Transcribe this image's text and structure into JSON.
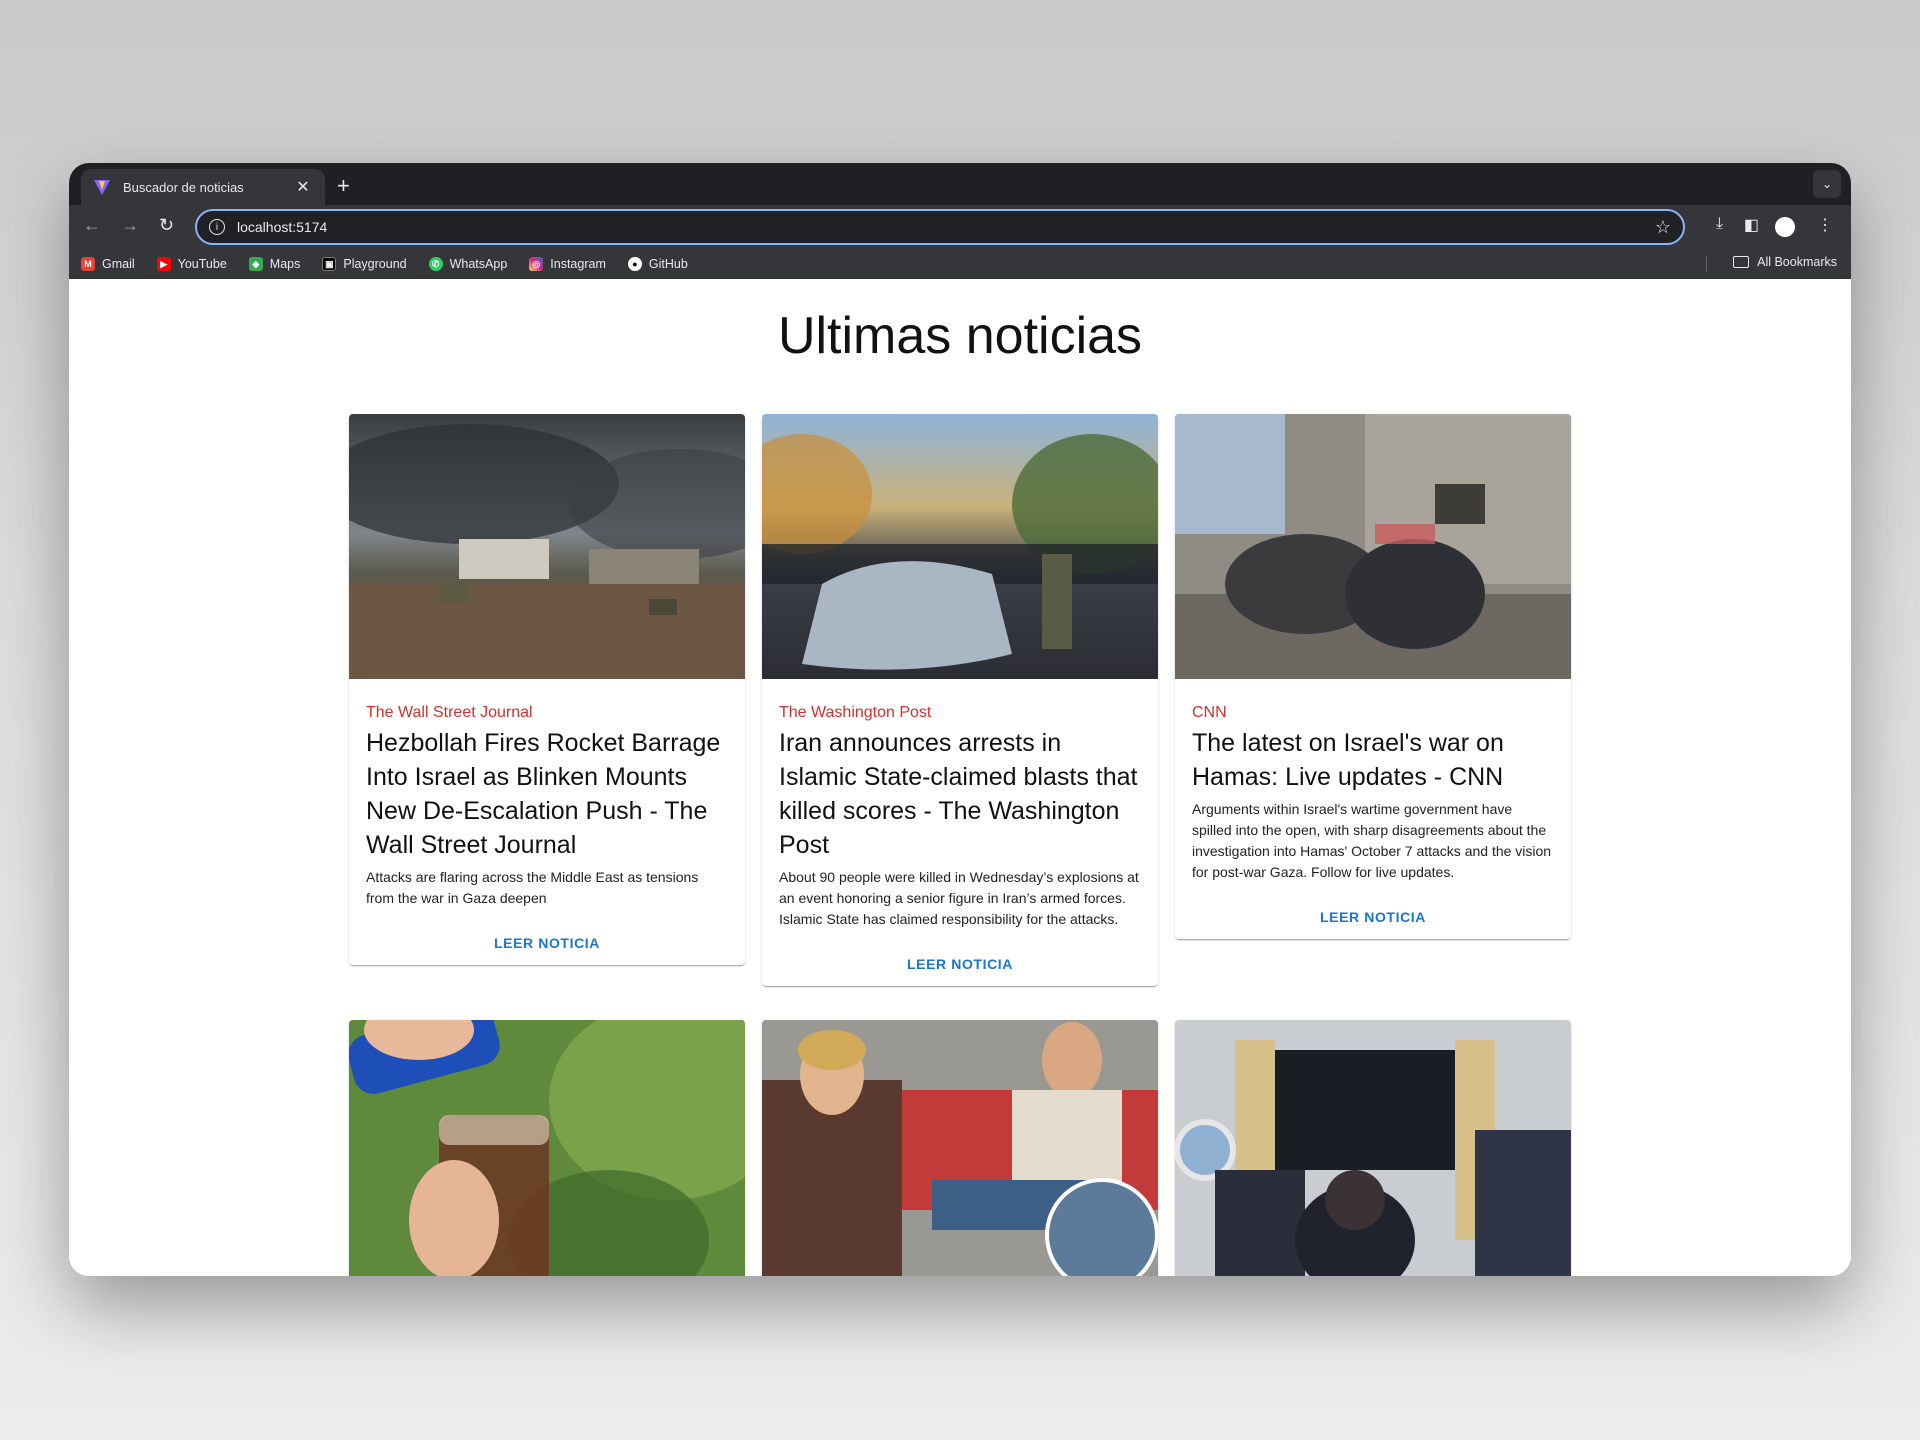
{
  "browser": {
    "tab_title": "Buscador de noticias",
    "url": "localhost:5174",
    "bookmarks": [
      {
        "label": "Gmail",
        "icon": "gmail-icon",
        "color": "#ea4335"
      },
      {
        "label": "YouTube",
        "icon": "youtube-icon",
        "color": "#ff0000"
      },
      {
        "label": "Maps",
        "icon": "maps-icon",
        "color": "#34a853"
      },
      {
        "label": "Playground",
        "icon": "playground-icon",
        "color": "#000000"
      },
      {
        "label": "WhatsApp",
        "icon": "whatsapp-icon",
        "color": "#25d366"
      },
      {
        "label": "Instagram",
        "icon": "instagram-icon",
        "color": "#e1306c"
      },
      {
        "label": "GitHub",
        "icon": "github-icon",
        "color": "#ffffff"
      }
    ],
    "all_bookmarks": "All Bookmarks"
  },
  "page": {
    "title": "Ultimas noticias",
    "action_label": "LEER NOTICIA",
    "articles": [
      {
        "source": "The Wall Street Journal",
        "headline": "Hezbollah Fires Rocket Barrage Into Israel as Blinken Mounts New De-Escalation Push - The Wall Street Journal",
        "description": "Attacks are flaring across the Middle East as tensions from the war in Gaza deepen"
      },
      {
        "source": "The Washington Post",
        "headline": "Iran announces arrests in Islamic State-claimed blasts that killed scores - The Washington Post",
        "description": "About 90 people were killed in Wednesday’s explosions at an event honoring a senior figure in Iran’s armed forces. Islamic State has claimed responsibility for the attacks."
      },
      {
        "source": "CNN",
        "headline": "The latest on Israel's war on Hamas: Live updates - CNN",
        "description": "Arguments within Israel's wartime government have spilled into the open, with sharp disagreements about the investigation into Hamas' October 7 attacks and the vision for post-war Gaza. Follow for live updates."
      }
    ]
  },
  "colors": {
    "source": "#d32f2f",
    "action": "#1976d2",
    "omnibox_focus": "#8ab4f8"
  }
}
